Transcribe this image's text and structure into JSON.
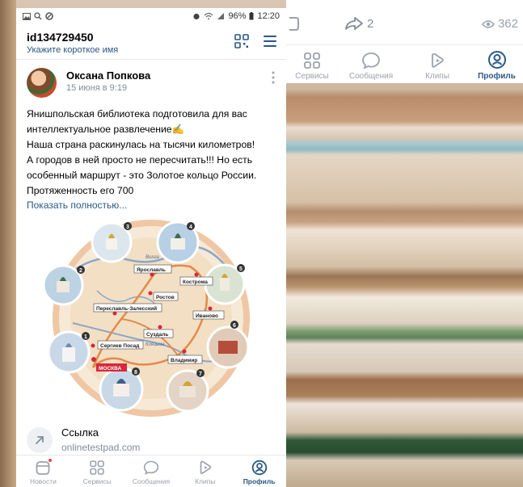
{
  "colors": {
    "accent": "#2a5885",
    "secondary_text": "#818c99",
    "nav_inactive": "#99a2ad",
    "notification_dot": "#e64646"
  },
  "status_bar": {
    "left_icons": [
      "gallery-icon",
      "search-icon",
      "circle-icon"
    ],
    "battery": "96%",
    "time": "12:20"
  },
  "profile_header": {
    "user_id": "id134729450",
    "subtitle": "Укажите короткое имя",
    "icons": [
      "qr-code-icon",
      "menu-icon"
    ]
  },
  "post": {
    "author": "Оксана Попкова",
    "date": "15 июня в 9:19",
    "text_lines": [
      "Янишпольская библиотека подготовила для вас",
      "интеллектуальное развлечение✍",
      "Наша страна раскинулась на тысячи километров!",
      "А городов в ней просто не пересчитать!!! Но есть",
      "особенный маршрут - это Золотое кольцо России.",
      "Протяженность его 700"
    ],
    "show_more": "Показать полностью...",
    "map": {
      "cities": [
        "Ярославль",
        "Кострома",
        "Ростов",
        "Переславль-Залесский",
        "Иваново",
        "Суздаль",
        "Сергиев Посад",
        "Владимир",
        "МОСКВА"
      ],
      "rivers": [
        "Волга",
        "Клязьма"
      ],
      "medallion_numbers": [
        "1",
        "2",
        "3",
        "4",
        "5",
        "6",
        "7",
        "8"
      ]
    },
    "link": {
      "title": "Ссылка",
      "url": "onlinetestpad.com"
    }
  },
  "bottom_nav": {
    "tabs": [
      {
        "label": "Новости",
        "icon": "news-icon",
        "active": false
      },
      {
        "label": "Сервисы",
        "icon": "services-icon",
        "active": false
      },
      {
        "label": "Сообщения",
        "icon": "messages-icon",
        "active": false
      },
      {
        "label": "Клипы",
        "icon": "clips-icon",
        "active": false
      },
      {
        "label": "Профиль",
        "icon": "profile-icon",
        "active": true
      }
    ]
  },
  "right_panel": {
    "share_count": "2",
    "views_count": "362",
    "tabs": [
      {
        "label": "Сервисы",
        "icon": "services-icon",
        "active": false
      },
      {
        "label": "Сообщения",
        "icon": "messages-icon",
        "active": false
      },
      {
        "label": "Клипы",
        "icon": "clips-icon",
        "active": false
      },
      {
        "label": "Профиль",
        "icon": "profile-icon",
        "active": true
      }
    ]
  }
}
